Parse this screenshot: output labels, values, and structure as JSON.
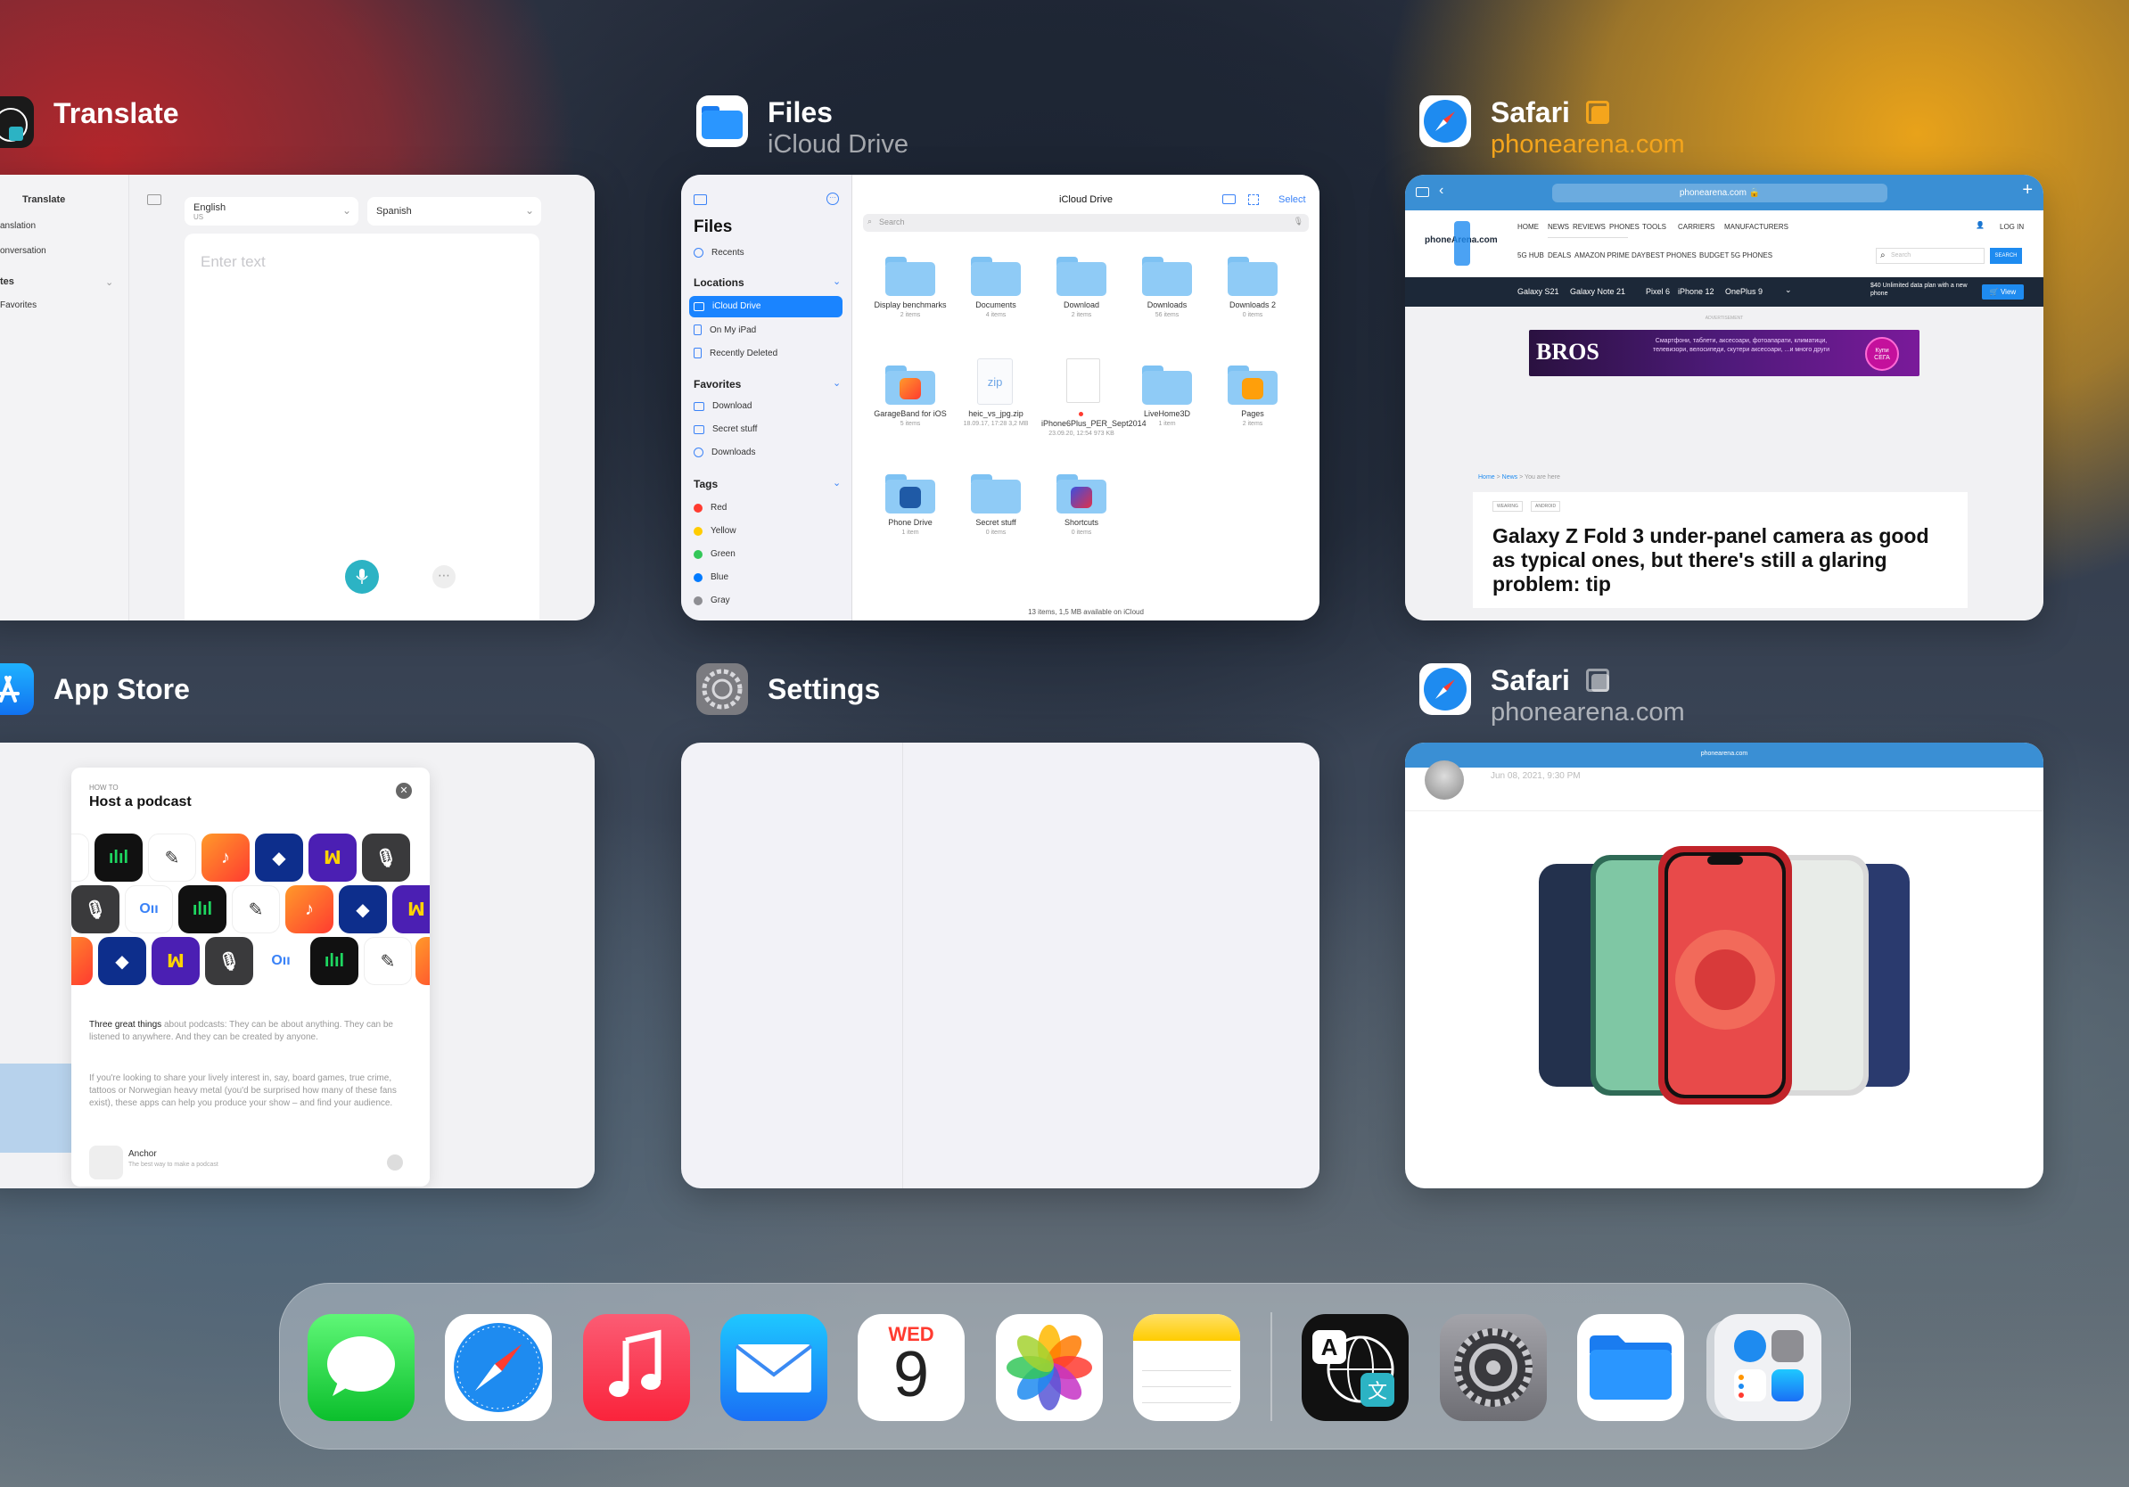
{
  "cards": {
    "translate": {
      "title": "Translate",
      "sidebar_title": "Translate",
      "sidebar_items": [
        "anslation",
        "onversation"
      ],
      "favorites_header": "tes",
      "favorites_item": "Favorites",
      "source_lang": "English",
      "source_region": "US",
      "target_lang": "Spanish",
      "placeholder": "Enter text"
    },
    "files": {
      "title": "Files",
      "subtitle": "iCloud Drive",
      "sidebar_title": "Files",
      "recents": "Recents",
      "locations_header": "Locations",
      "locations": [
        "iCloud Drive",
        "On My iPad",
        "Recently Deleted"
      ],
      "favorites_header": "Favorites",
      "favorites": [
        "Download",
        "Secret stuff",
        "Downloads"
      ],
      "tags_header": "Tags",
      "tags": [
        {
          "name": "Red",
          "color": "#ff3b30"
        },
        {
          "name": "Yellow",
          "color": "#ffcc00"
        },
        {
          "name": "Green",
          "color": "#34c759"
        },
        {
          "name": "Blue",
          "color": "#007aff"
        },
        {
          "name": "Gray",
          "color": "#8e8e93"
        }
      ],
      "main_title": "iCloud Drive",
      "select_label": "Select",
      "search_placeholder": "Search",
      "folders": [
        {
          "name": "Display benchmarks",
          "meta": "2 items"
        },
        {
          "name": "Documents",
          "meta": "4 items"
        },
        {
          "name": "Download",
          "meta": "2 items"
        },
        {
          "name": "Downloads",
          "meta": "56 items"
        },
        {
          "name": "Downloads 2",
          "meta": "0 items"
        },
        {
          "name": "GarageBand for iOS",
          "meta": "5 items"
        },
        {
          "name": "heic_vs_jpg.zip",
          "meta": "18.09.17, 17:28 3,2 MB"
        },
        {
          "name": "iPhone6Plus_PER_Sept2014",
          "meta": "23.09.20, 12:54 973 KB"
        },
        {
          "name": "LiveHome3D",
          "meta": "1 item"
        },
        {
          "name": "Pages",
          "meta": "2 items"
        },
        {
          "name": "Phone Drive",
          "meta": "1 item"
        },
        {
          "name": "Secret stuff",
          "meta": "0 items"
        },
        {
          "name": "Shortcuts",
          "meta": "0 items"
        }
      ],
      "zip_label": "zip",
      "footer": "13 items, 1,5 MB available on iCloud"
    },
    "safari1": {
      "title": "Safari",
      "subtitle": "phonearena.com",
      "url": "phonearena.com",
      "nav_items": [
        "HOME",
        "NEWS",
        "REVIEWS",
        "PHONES",
        "TOOLS",
        "CARRIERS",
        "MANUFACTURERS"
      ],
      "login": "LOG IN",
      "sub_nav": [
        "5G HUB",
        "DEALS",
        "AMAZON PRIME DAY",
        "BEST PHONES",
        "BUDGET 5G PHONES"
      ],
      "search_placeholder": "Search",
      "search_button": "SEARCH",
      "logo_text": "phoneArena.com",
      "trending": [
        "Galaxy S21",
        "Galaxy Note 21",
        "Pixel 6",
        "iPhone 12",
        "OnePlus 9"
      ],
      "promo": "$40 Unlimited data plan with a new phone",
      "view_button": "View",
      "advert_label": "ADVERTISEMENT",
      "ad_brand": "BROS",
      "ad_text": "Смартфони, таблети, аксесоари, фотоапарати, климатици, телевизори, велосипеди, скутери аксесоари, ...и много други",
      "ad_cta": "Купи СЕГА",
      "breadcrumb": [
        "Home",
        "News",
        "You are here"
      ],
      "tags": [
        "WEARING",
        "ANDROID"
      ],
      "headline": "Galaxy Z Fold 3 under-panel camera as good as typical ones, but there's still a glaring problem: tip"
    },
    "appstore": {
      "title": "App Store",
      "eyebrow": "HOW TO",
      "card_title": "Host a podcast",
      "body1_bold": "Three great things",
      "body1": " about podcasts: They can be about anything. They can be listened to anywhere. And they can be created by anyone.",
      "body2": "If you're looking to share your lively interest in, say, board games, true crime, tattoos or Norwegian heavy metal (you'd be surprised how many of these fans exist), these apps can help you produce your show – and find your audience.",
      "app_name": "Anchor",
      "app_desc": "The best way to make a podcast"
    },
    "settings": {
      "title": "Settings"
    },
    "safari2": {
      "title": "Safari",
      "subtitle": "phonearena.com",
      "url": "phonearena.com",
      "date": "Jun 08, 2021, 9:30 PM"
    }
  },
  "dock": {
    "calendar_day": "WED",
    "calendar_date": "9",
    "apps": [
      "messages-icon",
      "safari-icon",
      "music-icon",
      "mail-icon",
      "calendar-icon",
      "photos-icon",
      "notes-icon",
      "translate-icon",
      "settings-icon",
      "files-icon",
      "app-library-icon"
    ]
  },
  "colors": {
    "ios_blue": "#007aff",
    "safari_accent": "#f4a51c",
    "phonearena_blue": "#3a8fd4"
  }
}
